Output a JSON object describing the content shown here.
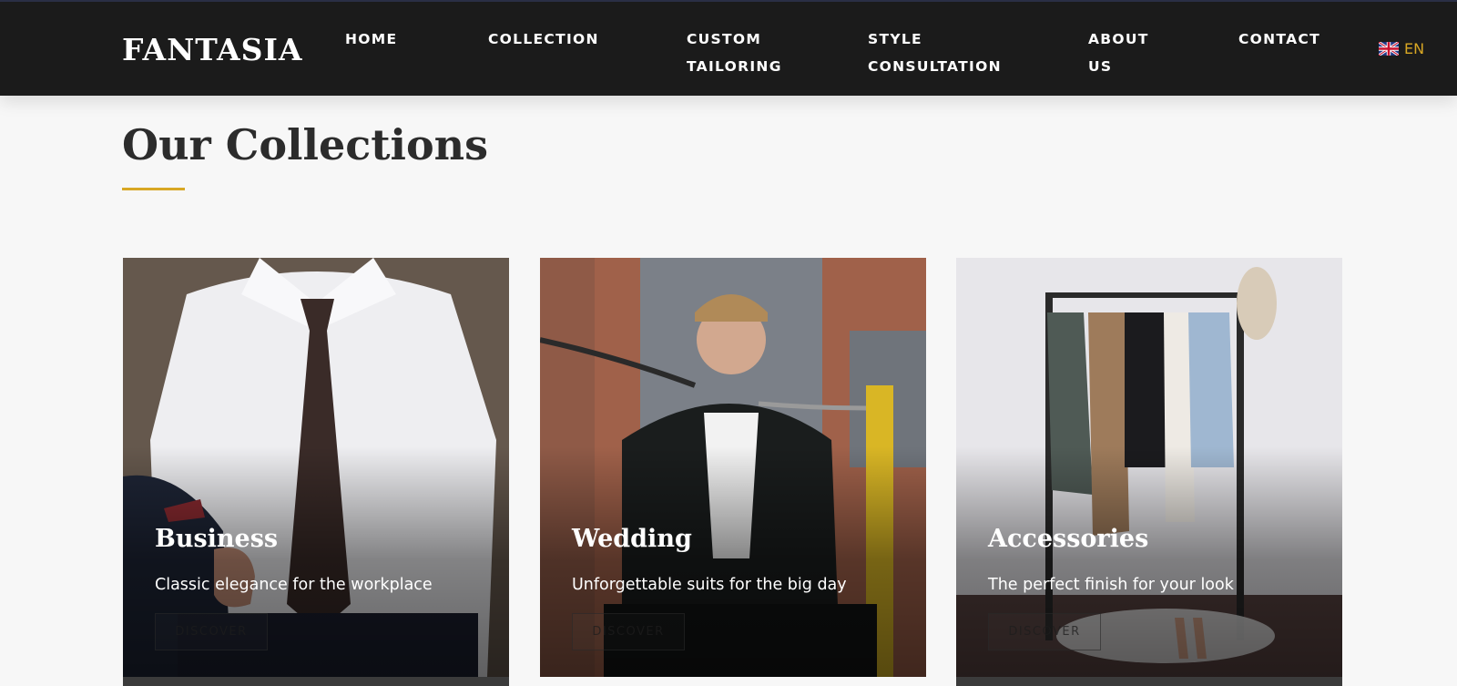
{
  "brand": {
    "logo": "FANTASIA"
  },
  "nav": {
    "items": [
      {
        "line1": "HOME",
        "line2": ""
      },
      {
        "line1": "COLLECTION",
        "line2": ""
      },
      {
        "line1": "CUSTOM",
        "line2": "TAILORING"
      },
      {
        "line1": "STYLE",
        "line2": "CONSULTATION"
      },
      {
        "line1": "ABOUT",
        "line2": "US"
      },
      {
        "line1": "CONTACT",
        "line2": ""
      }
    ],
    "language": {
      "code": "EN",
      "flag_icon": "uk-flag-icon"
    }
  },
  "section": {
    "title": "Our Collections"
  },
  "cards": [
    {
      "title": "Business",
      "subtitle": "Classic elegance for the workplace",
      "button": "DISCOVER"
    },
    {
      "title": "Wedding",
      "subtitle": "Unforgettable suits for the big day",
      "button": "DISCOVER"
    },
    {
      "title": "Accessories",
      "subtitle": "The perfect finish for your look",
      "button": "DISCOVER"
    }
  ],
  "colors": {
    "header_bg": "#1b1b1b",
    "accent": "#d8a724",
    "page_bg": "#f7f7f7",
    "text_dark": "#2c2c2c"
  }
}
